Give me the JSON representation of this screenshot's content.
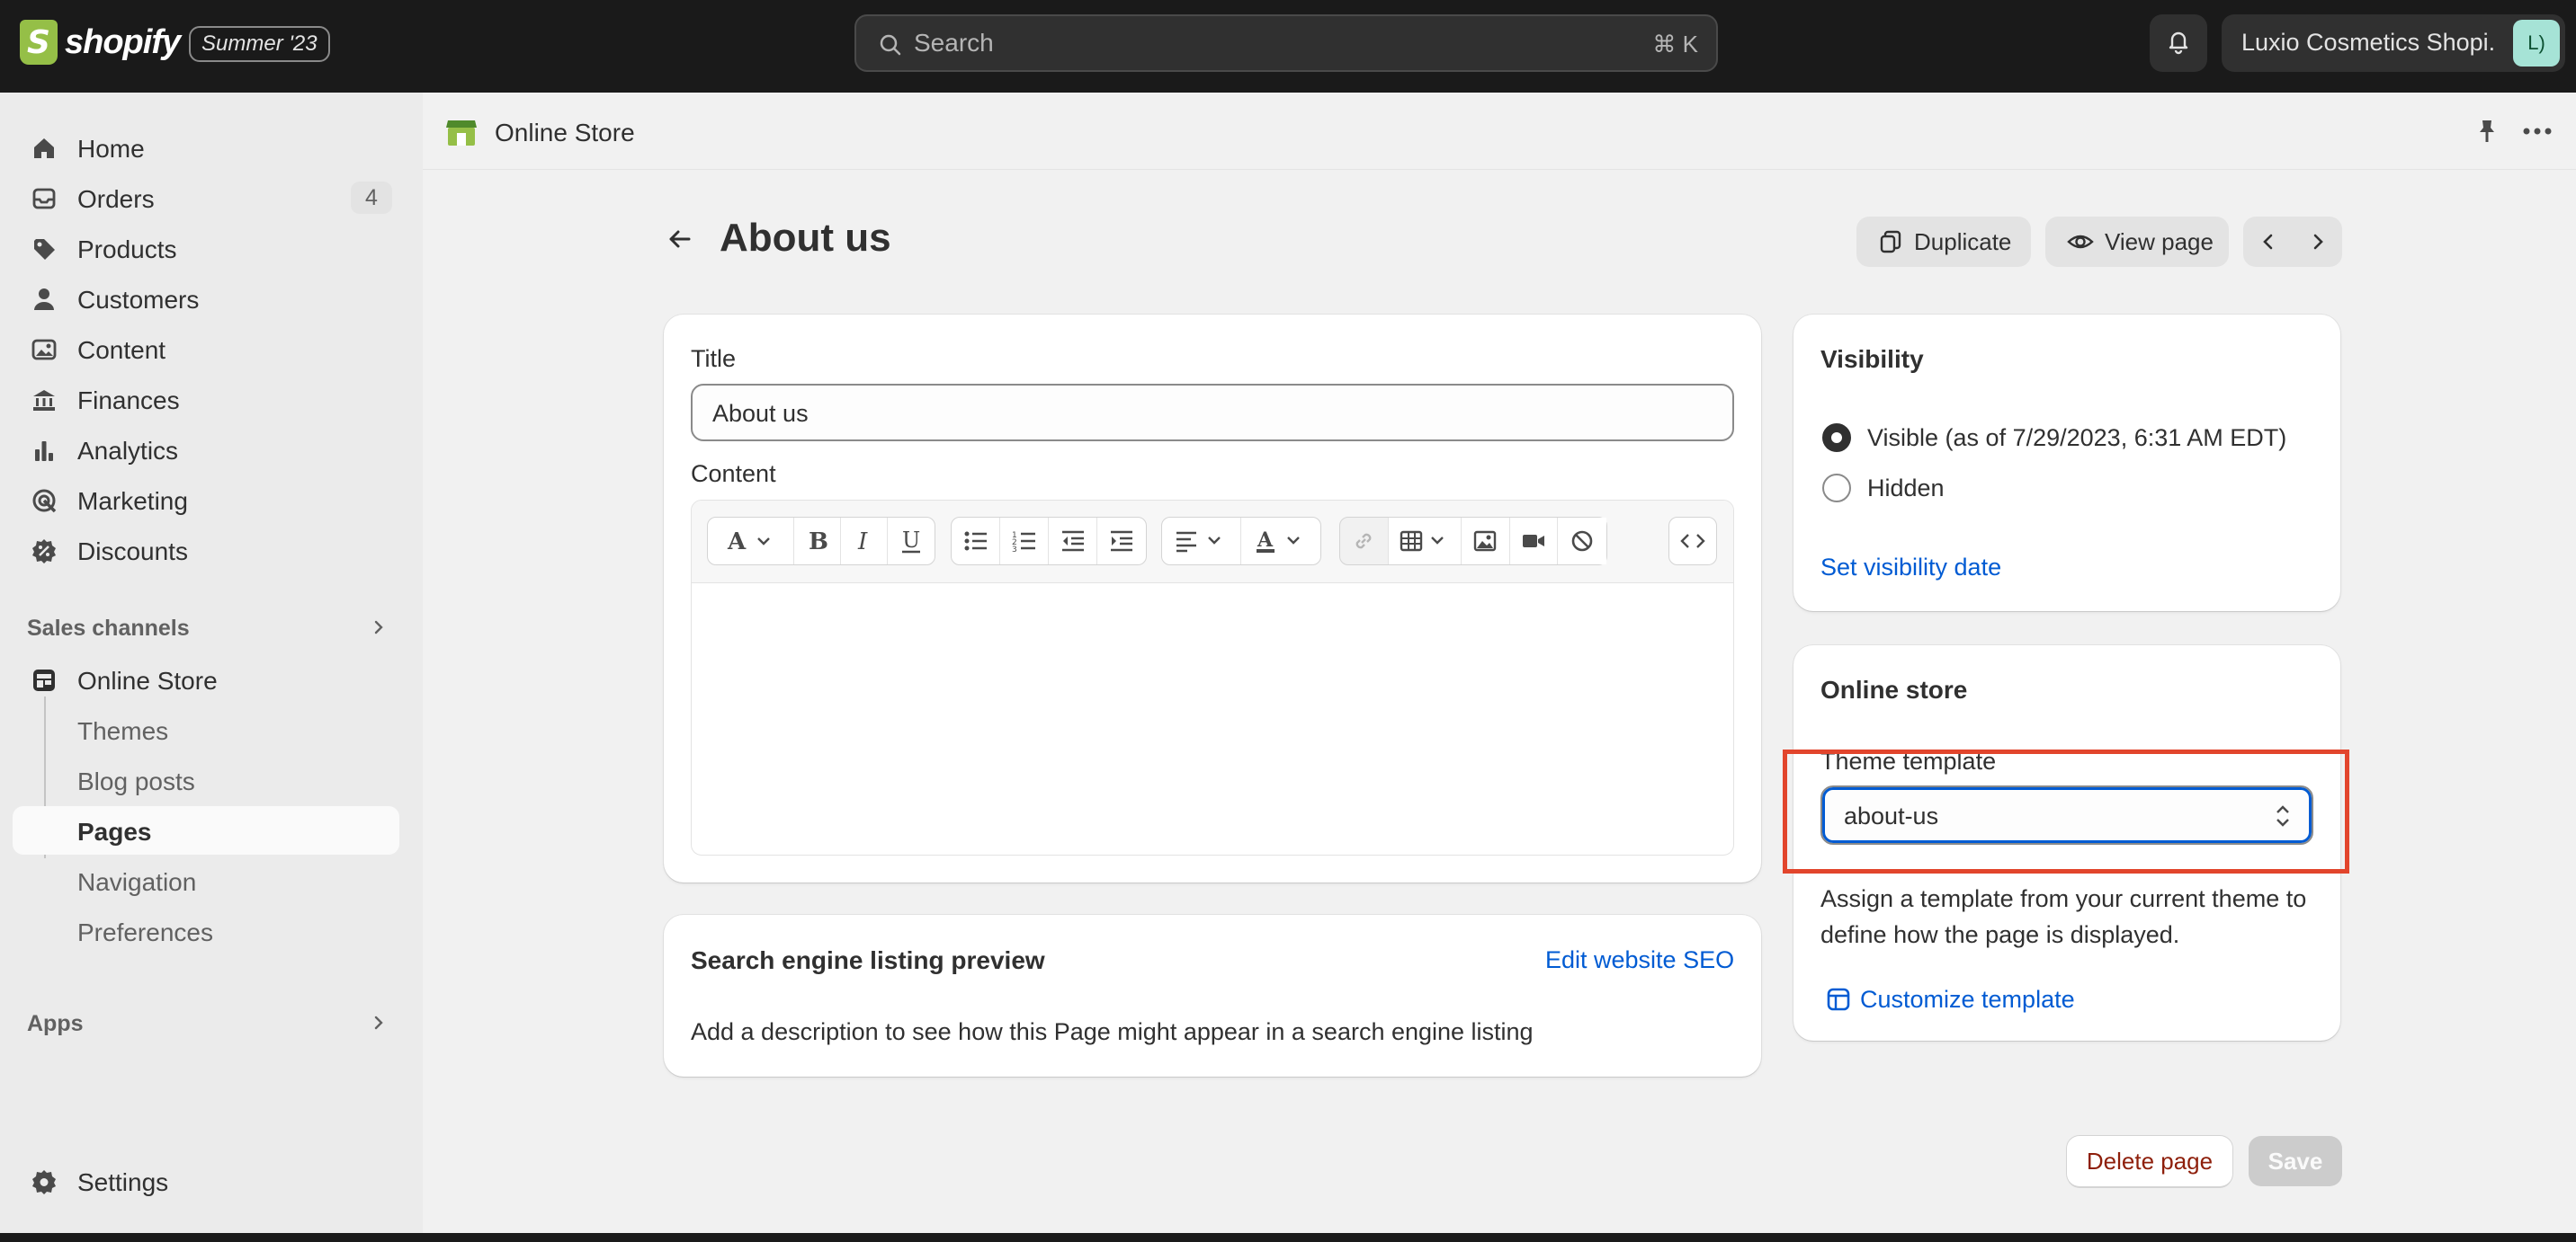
{
  "topbar": {
    "brand": "shopify",
    "brand_letter": "S",
    "edition_badge": "Summer '23",
    "search_placeholder": "Search",
    "search_shortcut": "⌘ K",
    "store_name": "Luxio Cosmetics Shopi...",
    "avatar_initials": "L)"
  },
  "sidebar": {
    "main_items": [
      {
        "label": "Home",
        "icon": "home-icon"
      },
      {
        "label": "Orders",
        "icon": "orders-icon",
        "count": "4"
      },
      {
        "label": "Products",
        "icon": "tag-icon"
      },
      {
        "label": "Customers",
        "icon": "person-icon"
      },
      {
        "label": "Content",
        "icon": "image-icon"
      },
      {
        "label": "Finances",
        "icon": "bank-icon"
      },
      {
        "label": "Analytics",
        "icon": "bar-chart-icon"
      },
      {
        "label": "Marketing",
        "icon": "target-icon"
      },
      {
        "label": "Discounts",
        "icon": "discount-icon"
      }
    ],
    "sales_channels_title": "Sales channels",
    "online_store_label": "Online Store",
    "online_store_sub": [
      {
        "label": "Themes"
      },
      {
        "label": "Blog posts"
      },
      {
        "label": "Pages",
        "active": true
      },
      {
        "label": "Navigation"
      },
      {
        "label": "Preferences"
      }
    ],
    "apps_title": "Apps",
    "settings_label": "Settings"
  },
  "breadcrumb": {
    "label": "Online Store"
  },
  "page": {
    "title": "About us",
    "duplicate_label": "Duplicate",
    "view_page_label": "View page"
  },
  "editor_card": {
    "title_label": "Title",
    "title_value": "About us",
    "content_label": "Content"
  },
  "seo_card": {
    "title": "Search engine listing preview",
    "edit_link": "Edit website SEO",
    "description": "Add a description to see how this Page might appear in a search engine listing"
  },
  "visibility_card": {
    "title": "Visibility",
    "options": [
      {
        "label": "Visible (as of 7/29/2023, 6:31 AM EDT)",
        "selected": true
      },
      {
        "label": "Hidden",
        "selected": false
      }
    ],
    "set_date_link": "Set visibility date"
  },
  "online_store_card": {
    "title": "Online store",
    "template_label": "Theme template",
    "template_value": "about-us",
    "help_text": "Assign a template from your current theme to define how the page is displayed.",
    "customize_link": "Customize template"
  },
  "footer_actions": {
    "delete_label": "Delete page",
    "save_label": "Save"
  },
  "colors": {
    "topbar_bg": "#1a1a1a",
    "sidebar_bg": "#ebebeb",
    "main_bg": "#f1f1f1",
    "link": "#005bd3",
    "highlight": "#e2452c",
    "destructive": "#8e1f0b",
    "brand_green": "#95bf47"
  }
}
